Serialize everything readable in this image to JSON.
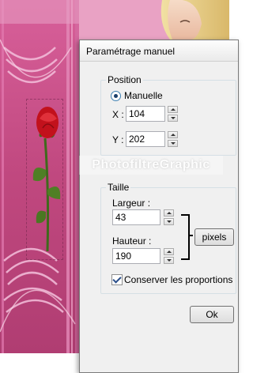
{
  "dialog": {
    "title": "Paramétrage manuel",
    "position": {
      "legend": "Position",
      "mode_label": "Manuelle",
      "x_label": "X :",
      "x_value": "104",
      "y_label": "Y :",
      "y_value": "202"
    },
    "size": {
      "legend": "Taille",
      "width_label": "Largeur :",
      "width_value": "43",
      "height_label": "Hauteur :",
      "height_value": "190",
      "unit_button": "pixels",
      "keep_proportions_label": "Conserver les proportions",
      "keep_proportions_checked": true
    },
    "ok_button": "Ok"
  },
  "watermark": "PhotofiltreGraphic",
  "colors": {
    "background_pink": "#c0487f",
    "rose_red": "#c2111c",
    "stem_green": "#3f6a1c"
  }
}
